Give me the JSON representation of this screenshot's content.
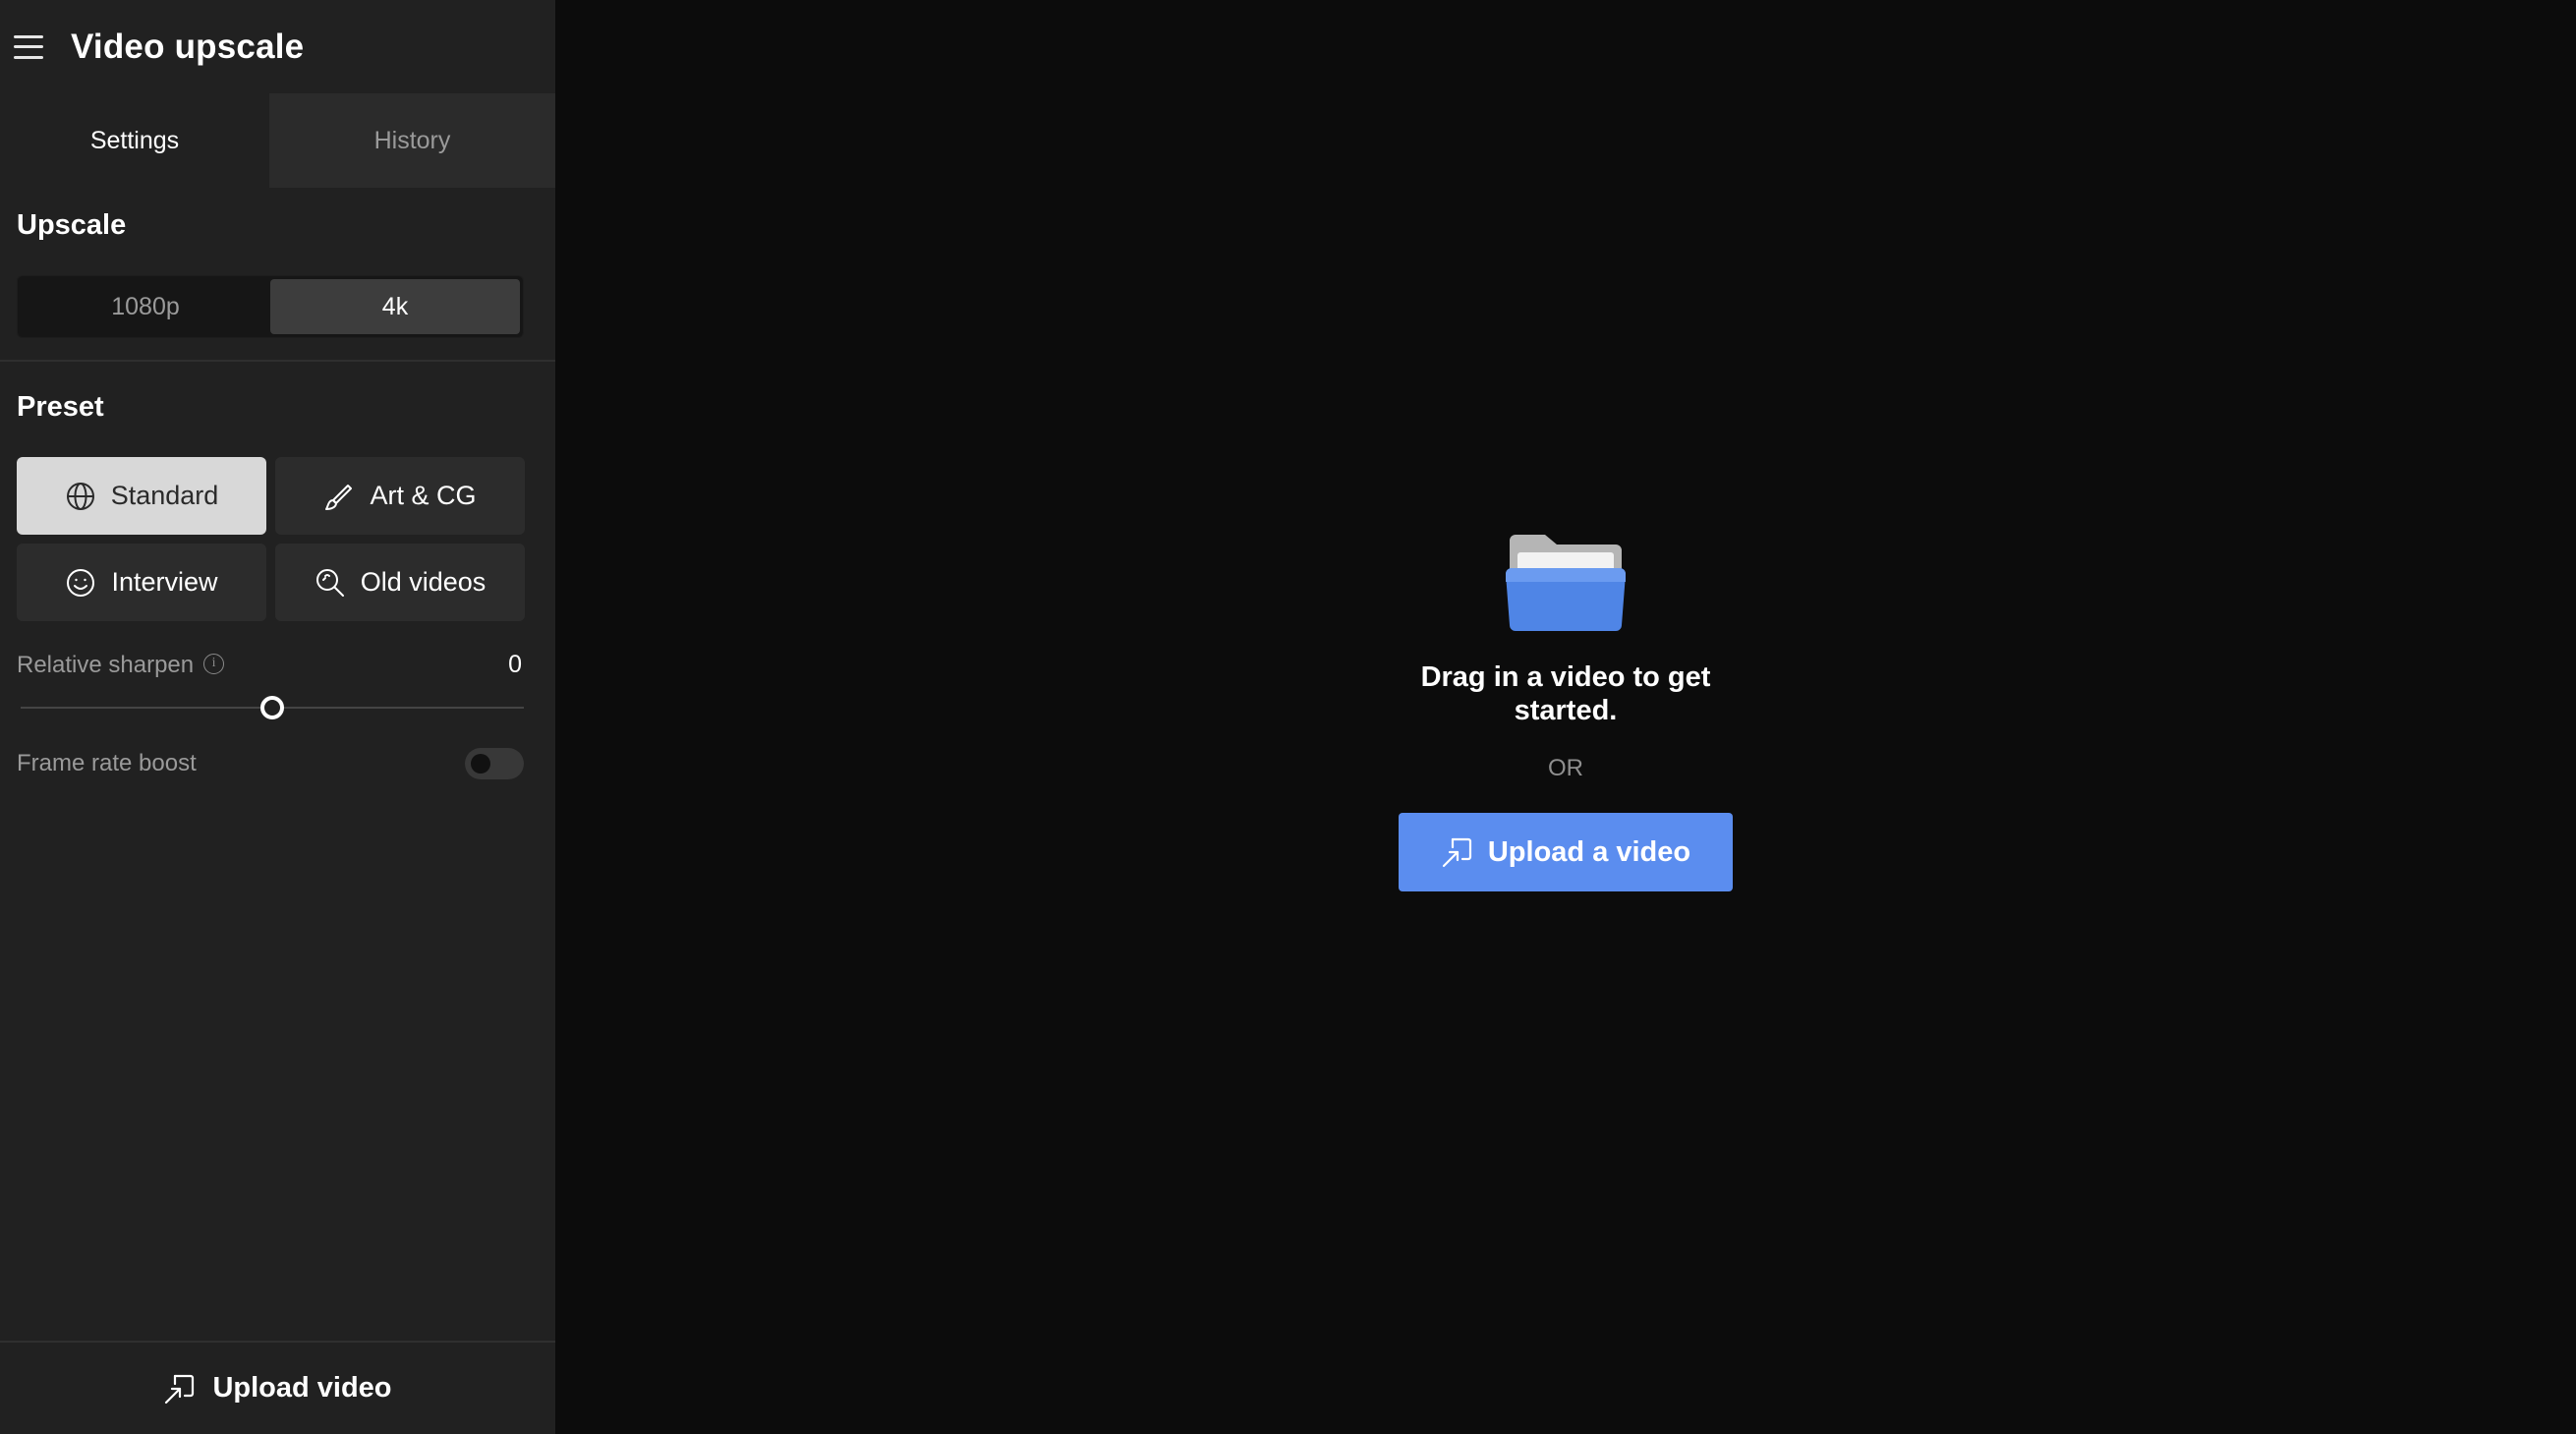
{
  "app": {
    "title": "Video upscale"
  },
  "tabs": [
    {
      "label": "Settings",
      "active": true
    },
    {
      "label": "History",
      "active": false
    }
  ],
  "upscale": {
    "title": "Upscale",
    "options": [
      "1080p",
      "4k"
    ],
    "selected": "4k"
  },
  "preset": {
    "title": "Preset",
    "options": [
      {
        "label": "Standard",
        "icon": "globe-icon",
        "selected": true
      },
      {
        "label": "Art & CG",
        "icon": "brush-icon",
        "selected": false
      },
      {
        "label": "Interview",
        "icon": "smiley-icon",
        "selected": false
      },
      {
        "label": "Old videos",
        "icon": "search-sparkle-icon",
        "selected": false
      }
    ]
  },
  "sharpen": {
    "label": "Relative sharpen",
    "value": "0",
    "level": 0.5
  },
  "frame_rate": {
    "label": "Frame rate boost",
    "enabled": false
  },
  "footer": {
    "upload_label": "Upload video"
  },
  "main": {
    "drop_text": "Drag in a video to get started.",
    "or_text": "OR",
    "upload_button": "Upload a video"
  },
  "colors": {
    "accent": "#5b8def",
    "sidebar_bg": "#212121",
    "main_bg": "#0c0c0c",
    "selected_preset_bg": "#d8d8d8"
  }
}
